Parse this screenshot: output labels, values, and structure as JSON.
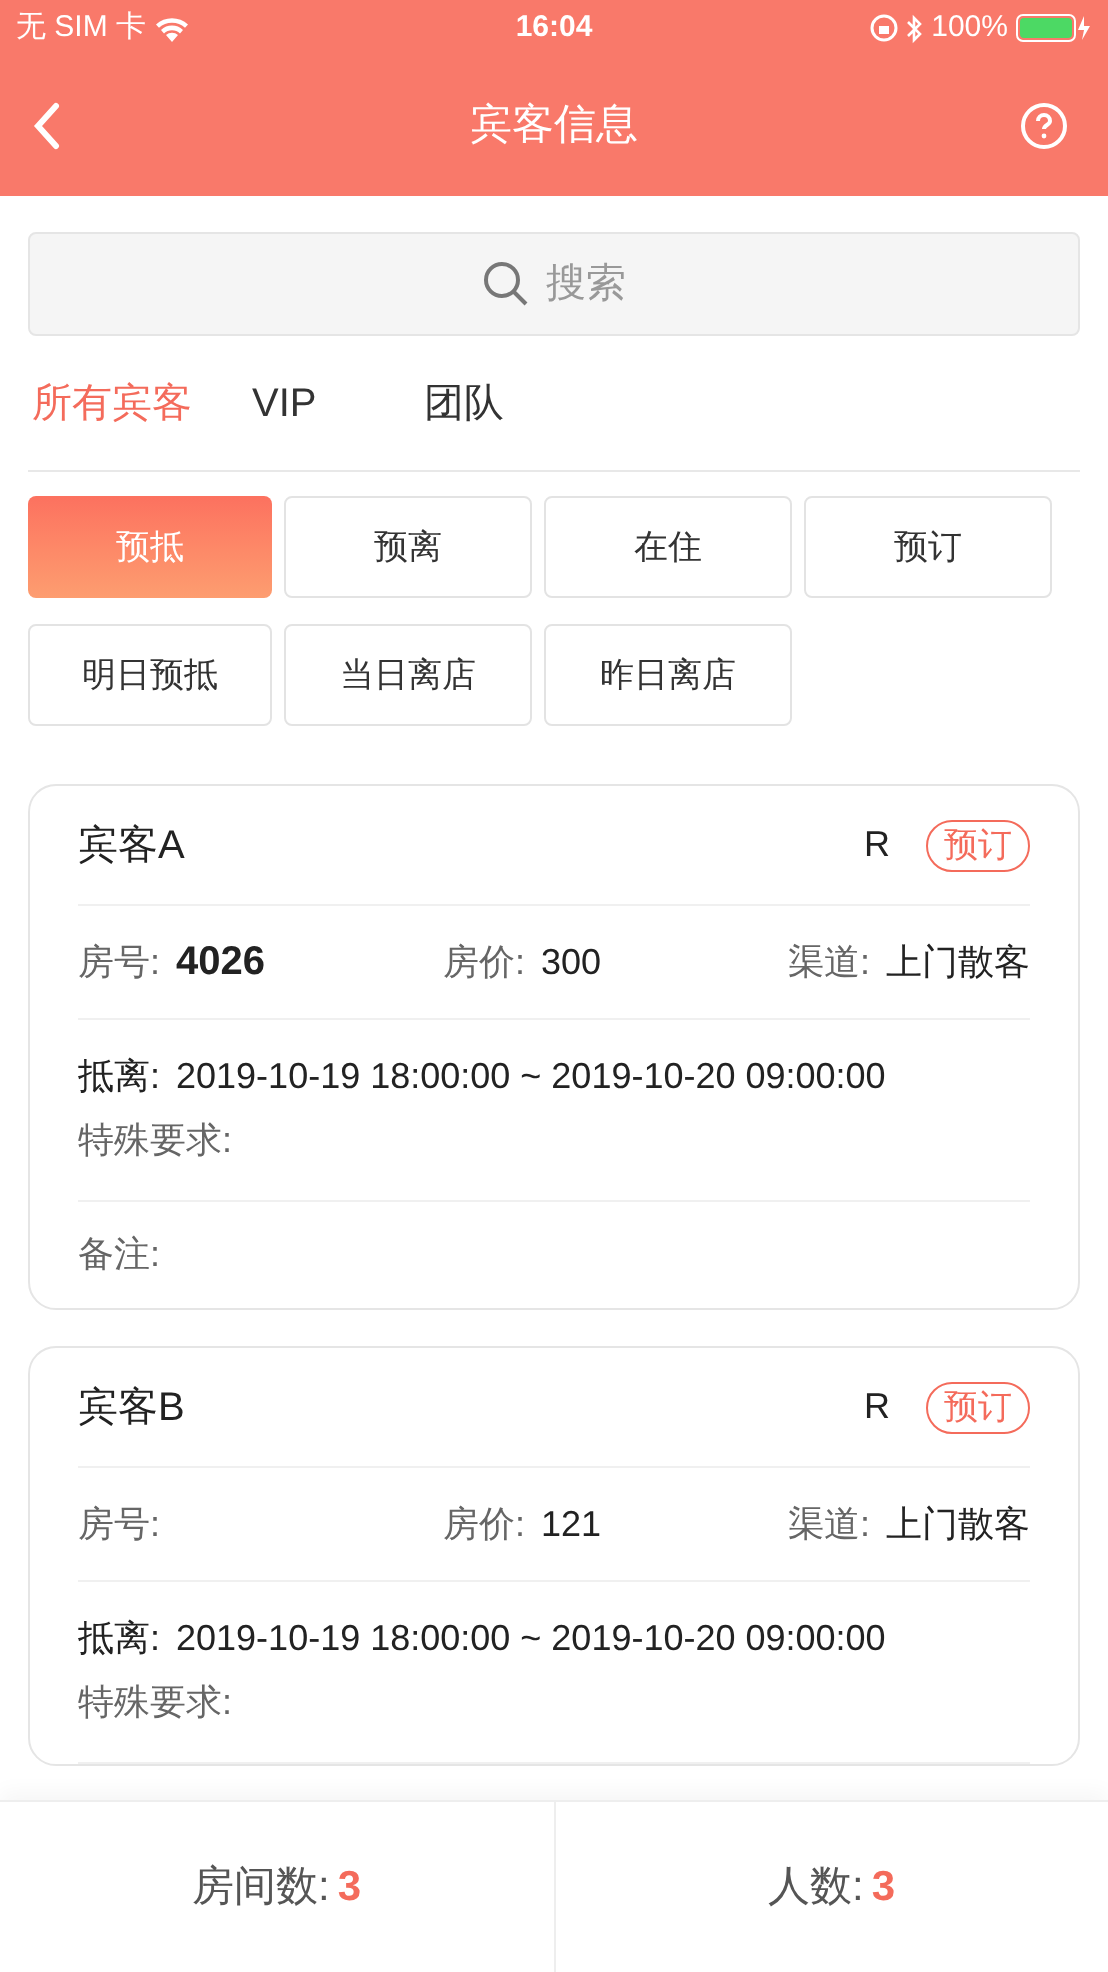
{
  "status_bar": {
    "carrier": "无 SIM 卡",
    "time": "16:04",
    "battery": "100%"
  },
  "nav": {
    "title": "宾客信息"
  },
  "search": {
    "placeholder": "搜索"
  },
  "tabs": [
    {
      "label": "所有宾客",
      "selected": true
    },
    {
      "label": "VIP",
      "selected": false
    },
    {
      "label": "团队",
      "selected": false
    }
  ],
  "filters": [
    {
      "label": "预抵",
      "selected": true
    },
    {
      "label": "预离",
      "selected": false
    },
    {
      "label": "在住",
      "selected": false
    },
    {
      "label": "预订",
      "selected": false
    },
    {
      "label": "明日预抵",
      "selected": false
    },
    {
      "label": "当日离店",
      "selected": false
    },
    {
      "label": "昨日离店",
      "selected": false
    }
  ],
  "guests": [
    {
      "name": "宾客A",
      "rank": "R",
      "status": "预订",
      "room_label": "房号:",
      "room": "4026",
      "price_label": "房价:",
      "price": "300",
      "channel_label": "渠道:",
      "channel": "上门散客",
      "stay_label": "抵离:",
      "stay": "2019-10-19 18:00:00 ~ 2019-10-20 09:00:00",
      "requests_label": "特殊要求:",
      "remarks_label": "备注:"
    },
    {
      "name": "宾客B",
      "rank": "R",
      "status": "预订",
      "room_label": "房号:",
      "price_label": "房价:",
      "price": "121",
      "channel_label": "渠道:",
      "channel": "上门散客",
      "stay_label": "抵离:",
      "stay": "2019-10-19 18:00:00 ~ 2019-10-20 09:00:00",
      "requests_label": "特殊要求:"
    }
  ],
  "footer": [
    {
      "label": "房间数:",
      "value": "3"
    },
    {
      "label": "人数:",
      "value": "3"
    }
  ]
}
